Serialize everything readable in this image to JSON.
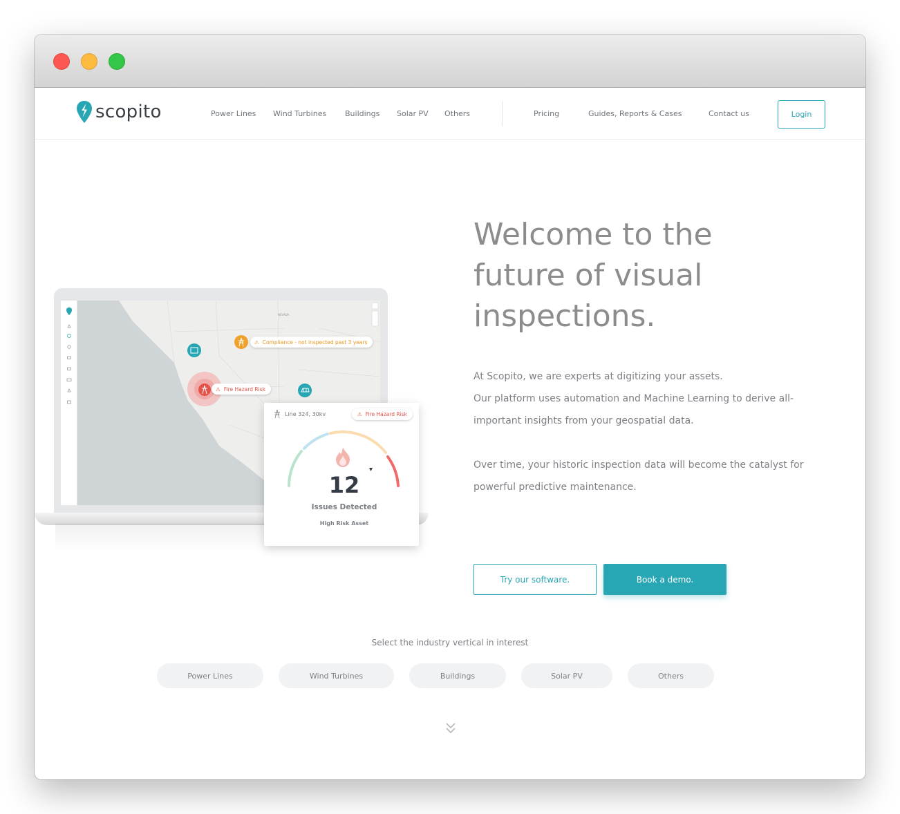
{
  "brand": {
    "name": "scopito",
    "accent": "#28a6b3"
  },
  "nav": {
    "items": [
      "Power Lines",
      "Wind Turbines",
      "Buildings",
      "Solar PV",
      "Others"
    ],
    "secondary": [
      "Pricing",
      "Guides, Reports & Cases",
      "Contact us"
    ],
    "login": "Login"
  },
  "hero": {
    "title_lines": [
      "Welcome to the",
      "future of visual",
      "inspections."
    ],
    "para1_lines": [
      "At Scopito, we are experts at digitizing your assets.",
      "Our platform uses automation and Machine Learning to derive all-",
      "important insights from your geospatial data."
    ],
    "para2_lines": [
      "Over time, your historic inspection data will become the catalyst for",
      "powerful predictive maintenance."
    ],
    "try_button": "Try our software.",
    "demo_button": "Book a demo."
  },
  "mockup": {
    "map_label": "NEVADA",
    "tag_compliance": "Compliance - not inspected past 3 years",
    "tag_fire": "Fire Hazard Risk",
    "card": {
      "line": "Line 324, 30kv",
      "badge": "Fire Hazard Risk",
      "number": "12",
      "issues": "Issues Detected",
      "risk": "High Risk Asset"
    }
  },
  "verticals": {
    "label": "Select the industry vertical in interest",
    "pills": [
      "Power Lines",
      "Wind Turbines",
      "Buildings",
      "Solar PV",
      "Others"
    ]
  },
  "icons": [
    "traffic-light-icons",
    "logo-pin-icon",
    "tower-icon",
    "building-icon",
    "warning-icon",
    "flame-icon",
    "chevron-double-down-icon"
  ]
}
